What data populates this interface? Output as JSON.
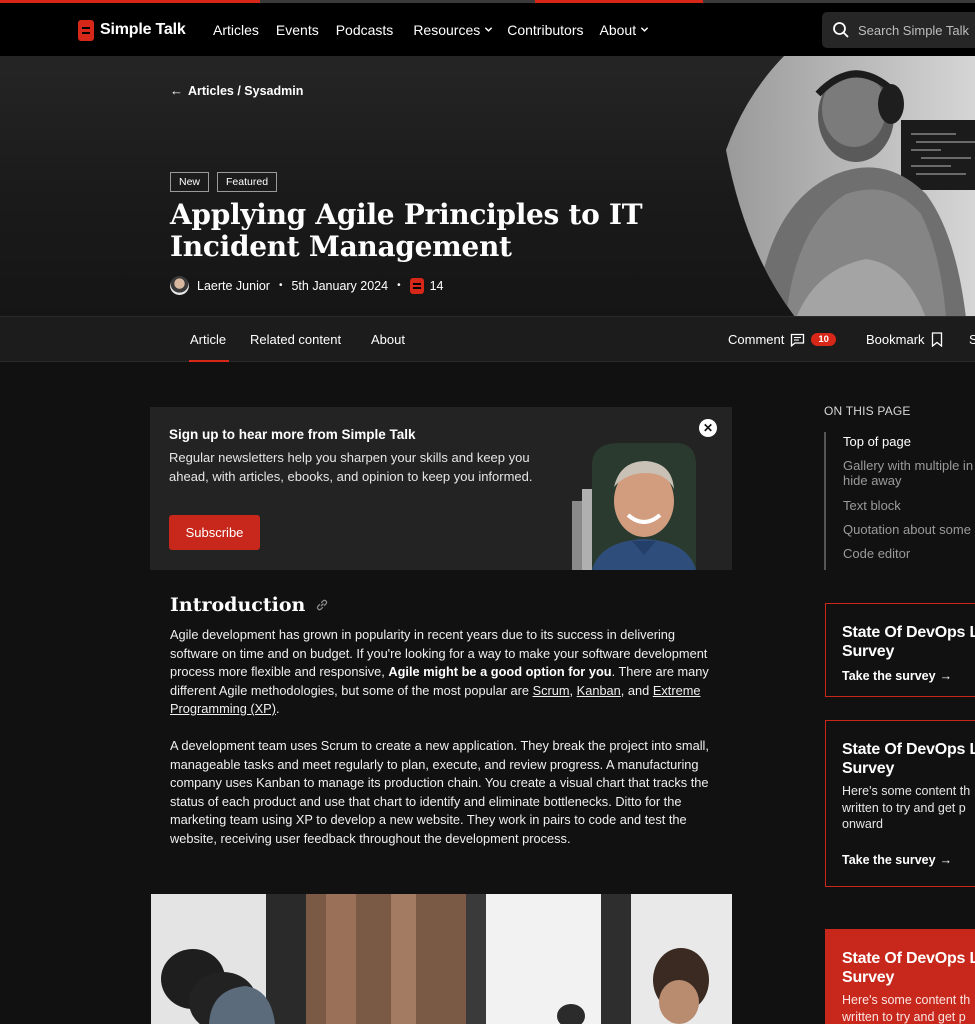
{
  "site": {
    "logo_text": "Simple Talk",
    "brand_color": "#d62718"
  },
  "nav": {
    "items": [
      {
        "label": "Articles",
        "has_menu": false
      },
      {
        "label": "Events",
        "has_menu": false
      },
      {
        "label": "Podcasts",
        "has_menu": false
      },
      {
        "label": "Resources",
        "has_menu": true
      },
      {
        "label": "Contributors",
        "has_menu": false
      },
      {
        "label": "About",
        "has_menu": true
      }
    ],
    "search_placeholder": "Search Simple Talk"
  },
  "hero": {
    "breadcrumb": "Articles / Sysadmin",
    "tags": [
      "New",
      "Featured"
    ],
    "title": "Applying Agile Principles to IT Incident Management",
    "author": "Laerte Junior",
    "date": "5th January 2024",
    "comment_count": "14"
  },
  "subnav": {
    "tabs": [
      "Article",
      "Related content",
      "About"
    ],
    "active_tab": "Article",
    "comment_label": "Comment",
    "comment_badge": "10",
    "bookmark_label": "Bookmark",
    "share_label": "S"
  },
  "newsletter": {
    "heading": "Sign up to hear more from Simple Talk",
    "body": "Regular newsletters help you sharpen your skills and keep you ahead, with articles, ebooks, and opinion to keep you informed.",
    "button_label": "Subscribe",
    "close_glyph": "✕"
  },
  "article": {
    "intro_heading": "Introduction",
    "p1": {
      "text_a": "Agile development has grown in popularity in recent years due to its success in delivering software on time and on budget. If you're looking for a way to make your software development process more flexible and responsive, ",
      "bold": "Agile might be a good option for you",
      "text_b": ". There are many different Agile methodologies, but some of the most popular are ",
      "link1": "Scrum",
      "sep1": ", ",
      "link2": "Kanban",
      "sep2": ", and ",
      "link3": "Extreme Programming (XP)",
      "end": "."
    },
    "p2": "A development team uses Scrum to create a new application. They break the project into small, manageable tasks and meet regularly to plan, execute, and review progress. A manufacturing company uses Kanban to manage its production chain. You create a visual chart that tracks the status of each product and use that chart to identify and eliminate bottlenecks. Ditto for the marketing team using XP to develop a new website. They work in pairs to code and test the website, receiving user feedback throughout the development process."
  },
  "toc": {
    "heading": "ON THIS PAGE",
    "items": [
      "Top of page",
      "Gallery with multiple in hide away",
      "Text block",
      "Quotation about some",
      "Code editor"
    ],
    "active_index": 0
  },
  "cards": [
    {
      "title": "State Of DevOps L Survey",
      "text": "",
      "link": "Take the survey",
      "filled": false
    },
    {
      "title": "State Of DevOps L Survey",
      "text": "Here's some content th written to try and get p onward",
      "link": "Take the survey",
      "filled": false
    },
    {
      "title": "State Of DevOps L Survey",
      "text": "Here's some content th written to try and get p",
      "link": "",
      "filled": true
    }
  ]
}
